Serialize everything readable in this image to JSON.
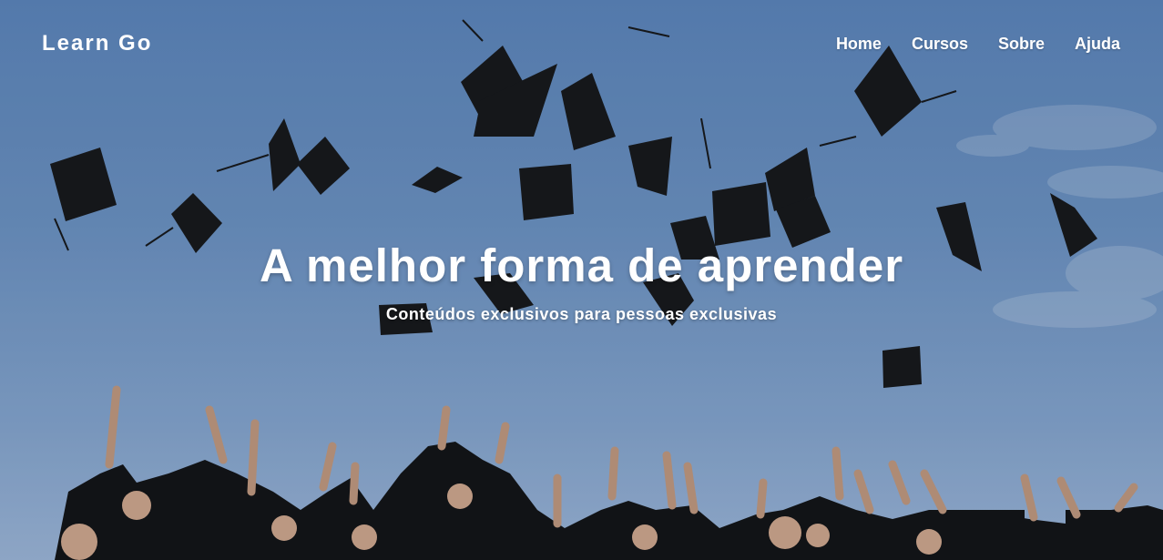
{
  "navbar": {
    "brand": "Learn Go",
    "links": [
      {
        "label": "Home"
      },
      {
        "label": "Cursos"
      },
      {
        "label": "Sobre"
      },
      {
        "label": "Ajuda"
      }
    ]
  },
  "hero": {
    "title": "A melhor forma de aprender",
    "subtitle": "Conteúdos exclusivos para pessoas exclusivas"
  },
  "colors": {
    "sky": "#6d93c2",
    "text": "#ffffff",
    "caps": "#151515",
    "gowns": "#141414"
  }
}
